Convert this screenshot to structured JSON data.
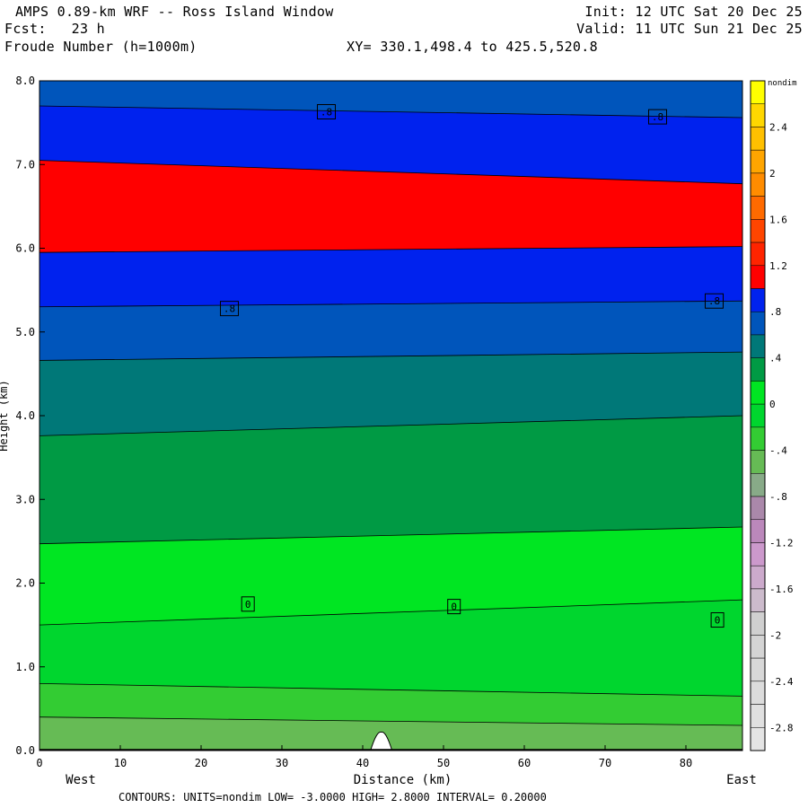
{
  "header": {
    "title": "AMPS 0.89-km WRF -- Ross Island Window",
    "forecast": "Fcst:   23 h",
    "init": "Init: 12 UTC Sat 20 Dec 25",
    "valid": "Valid: 11 UTC Sun 21 Dec 25",
    "field": "Froude Number (h=1000m)",
    "xy_range": "XY= 330.1,498.4 to 425.5,520.8"
  },
  "footer": {
    "contours_line": "CONTOURS:  UNITS=nondim  LOW= -3.0000        HIGH=  2.8000     INTERVAL=  0.20000"
  },
  "chart_data": {
    "type": "filled-contour",
    "title": "Froude Number (h=1000m)",
    "xlabel": "Distance (km)",
    "ylabel": "Height (km)",
    "x_end_labels": {
      "left": "West",
      "right": "East"
    },
    "xlim": [
      0,
      87
    ],
    "ylim": [
      0,
      8
    ],
    "x_ticks": [
      0,
      10,
      20,
      30,
      40,
      50,
      60,
      70,
      80
    ],
    "x_tick_labels": [
      "0",
      "10",
      "20",
      "30",
      "40",
      "50",
      "60",
      "70",
      "80"
    ],
    "y_ticks": [
      0,
      1,
      2,
      3,
      4,
      5,
      6,
      7,
      8
    ],
    "y_tick_labels": [
      "0.0",
      "1.0",
      "2.0",
      "3.0",
      "4.0",
      "5.0",
      "6.0",
      "7.0",
      "8.0"
    ],
    "colorbar": {
      "units": "nondim",
      "tick_labels": [
        "2.4",
        "2",
        "1.6",
        "1.2",
        ".8",
        ".4",
        "0",
        "-.4",
        "-.8",
        "-1.2",
        "-1.6",
        "-2",
        "-2.4",
        "-2.8"
      ],
      "tick_values": [
        2.4,
        2.0,
        1.6,
        1.2,
        0.8,
        0.4,
        0.0,
        -0.4,
        -0.8,
        -1.2,
        -1.6,
        -2.0,
        -2.4,
        -2.8
      ],
      "color_bins": [
        {
          "from": 2.6,
          "to": 2.8,
          "color": "#ffff00"
        },
        {
          "from": 2.4,
          "to": 2.6,
          "color": "#ffd700"
        },
        {
          "from": 2.2,
          "to": 2.4,
          "color": "#ffc000"
        },
        {
          "from": 2.0,
          "to": 2.2,
          "color": "#ffa500"
        },
        {
          "from": 1.8,
          "to": 2.0,
          "color": "#ff8c00"
        },
        {
          "from": 1.6,
          "to": 1.8,
          "color": "#ff6a00"
        },
        {
          "from": 1.4,
          "to": 1.6,
          "color": "#ff4500"
        },
        {
          "from": 1.2,
          "to": 1.4,
          "color": "#ff2400"
        },
        {
          "from": 1.0,
          "to": 1.2,
          "color": "#ff0000"
        },
        {
          "from": 0.8,
          "to": 1.0,
          "color": "#0022ee"
        },
        {
          "from": 0.6,
          "to": 0.8,
          "color": "#0055bb"
        },
        {
          "from": 0.4,
          "to": 0.6,
          "color": "#007878"
        },
        {
          "from": 0.2,
          "to": 0.4,
          "color": "#009a44"
        },
        {
          "from": 0.0,
          "to": 0.2,
          "color": "#00e622"
        },
        {
          "from": -0.2,
          "to": 0.0,
          "color": "#00d62e"
        },
        {
          "from": -0.4,
          "to": -0.2,
          "color": "#33cc33"
        },
        {
          "from": -0.6,
          "to": -0.4,
          "color": "#66bb55"
        },
        {
          "from": -0.8,
          "to": -0.6,
          "color": "#88aa88"
        },
        {
          "from": -1.0,
          "to": -0.8,
          "color": "#aa88aa"
        },
        {
          "from": -1.2,
          "to": -1.0,
          "color": "#bb88bb"
        },
        {
          "from": -1.4,
          "to": -1.2,
          "color": "#cc99cc"
        },
        {
          "from": -1.6,
          "to": -1.4,
          "color": "#ccaacc"
        },
        {
          "from": -1.8,
          "to": -1.6,
          "color": "#ccbbcc"
        },
        {
          "from": -2.0,
          "to": -1.8,
          "color": "#d0d0d0"
        },
        {
          "from": -2.2,
          "to": -2.0,
          "color": "#d4d4d4"
        },
        {
          "from": -2.4,
          "to": -2.2,
          "color": "#d8d8d8"
        },
        {
          "from": -2.6,
          "to": -2.4,
          "color": "#dcdcdc"
        },
        {
          "from": -2.8,
          "to": -2.6,
          "color": "#e0e0e0"
        },
        {
          "from": -3.0,
          "to": -2.8,
          "color": "#e4e4e4"
        }
      ]
    },
    "layers": [
      {
        "value": 0.8,
        "color": "#0055bb",
        "top_height": [
          8.0,
          8.0
        ]
      },
      {
        "value": 0.9,
        "color": "#0022ee",
        "top_height": [
          7.7,
          7.56
        ]
      },
      {
        "value": 1.1,
        "color": "#ff0000",
        "top_height": [
          7.05,
          6.77
        ]
      },
      {
        "value": 0.9,
        "color": "#0022ee",
        "top_height": [
          5.95,
          6.02
        ]
      },
      {
        "value": 0.7,
        "color": "#0055bb",
        "top_height": [
          5.3,
          5.37
        ]
      },
      {
        "value": 0.5,
        "color": "#007878",
        "top_height": [
          4.66,
          4.76
        ]
      },
      {
        "value": 0.3,
        "color": "#009a44",
        "top_height": [
          3.76,
          4.0
        ]
      },
      {
        "value": 0.1,
        "color": "#00e622",
        "top_height": [
          2.47,
          2.67
        ]
      },
      {
        "value": -0.1,
        "color": "#00d62e",
        "top_height": [
          1.5,
          1.8
        ]
      },
      {
        "value": -0.3,
        "color": "#33cc33",
        "top_height": [
          0.8,
          0.65
        ]
      },
      {
        "value": -0.5,
        "color": "#66bb55",
        "top_height": [
          0.4,
          0.3
        ]
      }
    ],
    "contour_labels": [
      {
        "text": ".8",
        "x": 35.5,
        "y": 7.63
      },
      {
        "text": ".8",
        "x": 76.5,
        "y": 7.57
      },
      {
        "text": ".8",
        "x": 23.5,
        "y": 5.28
      },
      {
        "text": ".8",
        "x": 83.5,
        "y": 5.37
      },
      {
        "text": "0",
        "x": 25.8,
        "y": 1.75
      },
      {
        "text": "0",
        "x": 51.3,
        "y": 1.72
      },
      {
        "text": "0",
        "x": 83.9,
        "y": 1.56
      }
    ],
    "terrain_peak": {
      "x": 42.3,
      "height": 0.22
    }
  }
}
